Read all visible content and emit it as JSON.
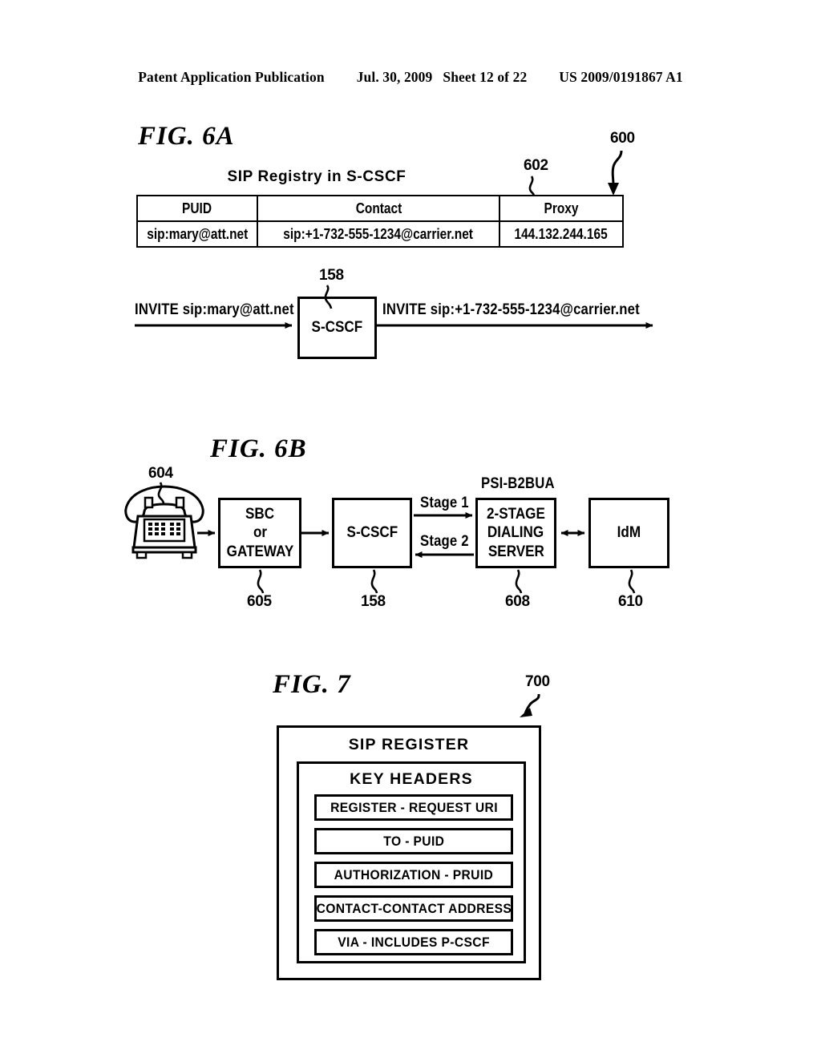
{
  "header": {
    "publication": "Patent Application Publication",
    "date": "Jul. 30, 2009",
    "sheet": "Sheet 12 of 22",
    "patent_number": "US 2009/0191867 A1"
  },
  "fig6a": {
    "title": "FIG. 6A",
    "ref_main": "600",
    "ref_table": "602",
    "ref_scscf": "158",
    "table_caption": "SIP Registry in S-CSCF",
    "table": {
      "headers": [
        "PUID",
        "Contact",
        "Proxy"
      ],
      "rows": [
        [
          "sip:mary@att.net",
          "sip:+1-732-555-1234@carrier.net",
          "144.132.244.165"
        ]
      ]
    },
    "flow": {
      "input_label": "INVITE sip:mary@att.net",
      "node_label": "S-CSCF",
      "output_label": "INVITE sip:+1-732-555-1234@carrier.net"
    }
  },
  "fig6b": {
    "title": "FIG. 6B",
    "phone_ref": "604",
    "psi_label": "PSI-B2BUA",
    "stage1_label": "Stage 1",
    "stage2_label": "Stage 2",
    "nodes": [
      {
        "lines": [
          "SBC",
          "or",
          "GATEWAY"
        ],
        "ref": "605"
      },
      {
        "lines": [
          "S-CSCF"
        ],
        "ref": "158"
      },
      {
        "lines": [
          "2-STAGE",
          "DIALING",
          "SERVER"
        ],
        "ref": "608"
      },
      {
        "lines": [
          "IdM"
        ],
        "ref": "610"
      }
    ]
  },
  "fig7": {
    "title": "FIG. 7",
    "ref_main": "700",
    "outer_title": "SIP REGISTER",
    "inner_title": "KEY HEADERS",
    "rows": [
      "REGISTER - REQUEST URI",
      "TO    -    PUID",
      "AUTHORIZATION - PRUID",
      "CONTACT-CONTACT ADDRESS",
      "VIA - INCLUDES P-CSCF"
    ]
  },
  "colors": {
    "ink": "#000000",
    "paper": "#ffffff"
  }
}
